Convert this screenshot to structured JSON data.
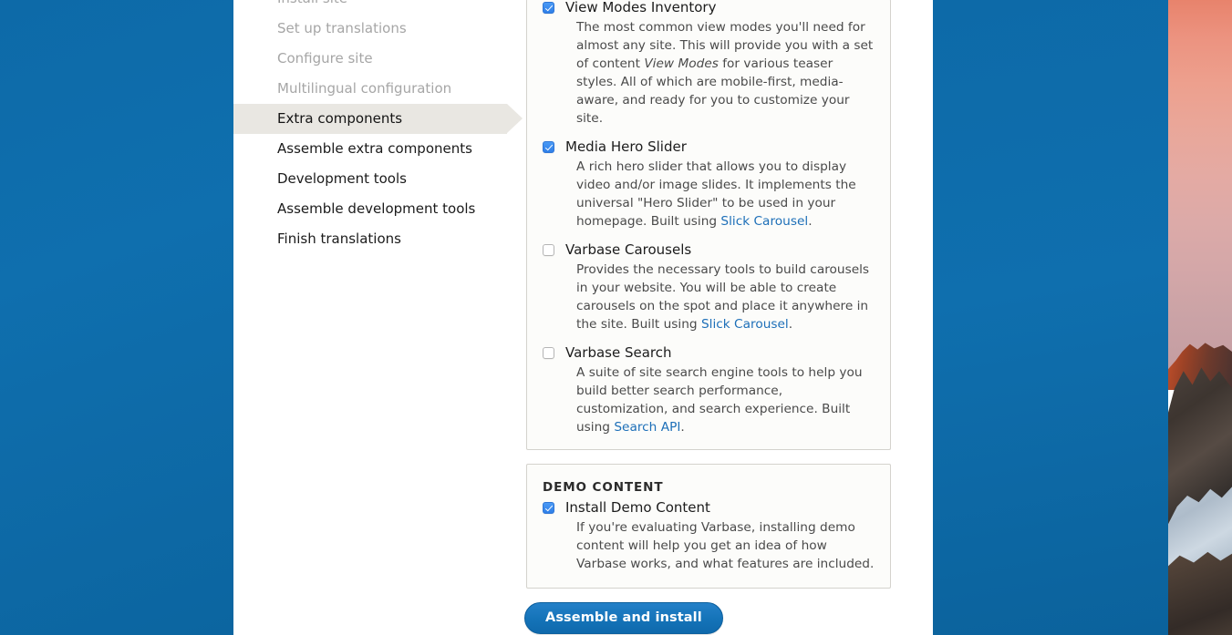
{
  "desktop": {
    "background_color": "#0d6aa8",
    "wallpaper_name": "mountain-sunset-wallpaper"
  },
  "sidebar": {
    "items": [
      {
        "label": "Install site",
        "state": "done"
      },
      {
        "label": "Set up translations",
        "state": "done"
      },
      {
        "label": "Configure site",
        "state": "done"
      },
      {
        "label": "Multilingual configuration",
        "state": "done"
      },
      {
        "label": "Extra components",
        "state": "active"
      },
      {
        "label": "Assemble extra components",
        "state": "pending"
      },
      {
        "label": "Development tools",
        "state": "pending"
      },
      {
        "label": "Assemble development tools",
        "state": "pending"
      },
      {
        "label": "Finish translations",
        "state": "pending"
      }
    ]
  },
  "components_panel": {
    "options": [
      {
        "label": "View Modes Inventory",
        "checked": true,
        "description_parts": [
          {
            "type": "text",
            "text": "The most common view modes you'll need for almost any site. This will provide you with a set of content "
          },
          {
            "type": "em",
            "text": "View Modes"
          },
          {
            "type": "text",
            "text": " for various teaser styles. All of which are mobile-first, media-aware, and ready for you to customize your site."
          }
        ]
      },
      {
        "label": "Media Hero Slider",
        "checked": true,
        "description_parts": [
          {
            "type": "text",
            "text": "A rich hero slider that allows you to display video and/or image slides. It implements the universal \"Hero Slider\" to be used in your homepage. Built using "
          },
          {
            "type": "link",
            "text": "Slick Carousel"
          },
          {
            "type": "text",
            "text": "."
          }
        ]
      },
      {
        "label": "Varbase Carousels",
        "checked": false,
        "description_parts": [
          {
            "type": "text",
            "text": "Provides the necessary tools to build carousels in your website. You will be able to create carousels on the spot and place it anywhere in the site. Built using "
          },
          {
            "type": "link",
            "text": "Slick Carousel"
          },
          {
            "type": "text",
            "text": "."
          }
        ]
      },
      {
        "label": "Varbase Search",
        "checked": false,
        "description_parts": [
          {
            "type": "text",
            "text": "A suite of site search engine tools to help you build better search performance, customization, and search experience. Built using "
          },
          {
            "type": "link",
            "text": "Search API"
          },
          {
            "type": "text",
            "text": "."
          }
        ]
      }
    ]
  },
  "demo_panel": {
    "legend": "DEMO CONTENT",
    "options": [
      {
        "label": "Install Demo Content",
        "checked": true,
        "description_parts": [
          {
            "type": "text",
            "text": "If you're evaluating Varbase, installing demo content will help you get an idea of how Varbase works, and what features are included."
          }
        ]
      }
    ]
  },
  "actions": {
    "submit_label": "Assemble and install"
  },
  "colors": {
    "link": "#1d6fb8",
    "checkbox_checked": "#2f7fe8",
    "button": "#1473b8",
    "active_step_bg": "#e9e7e2",
    "desktop_blue": "#0d6aa8"
  }
}
